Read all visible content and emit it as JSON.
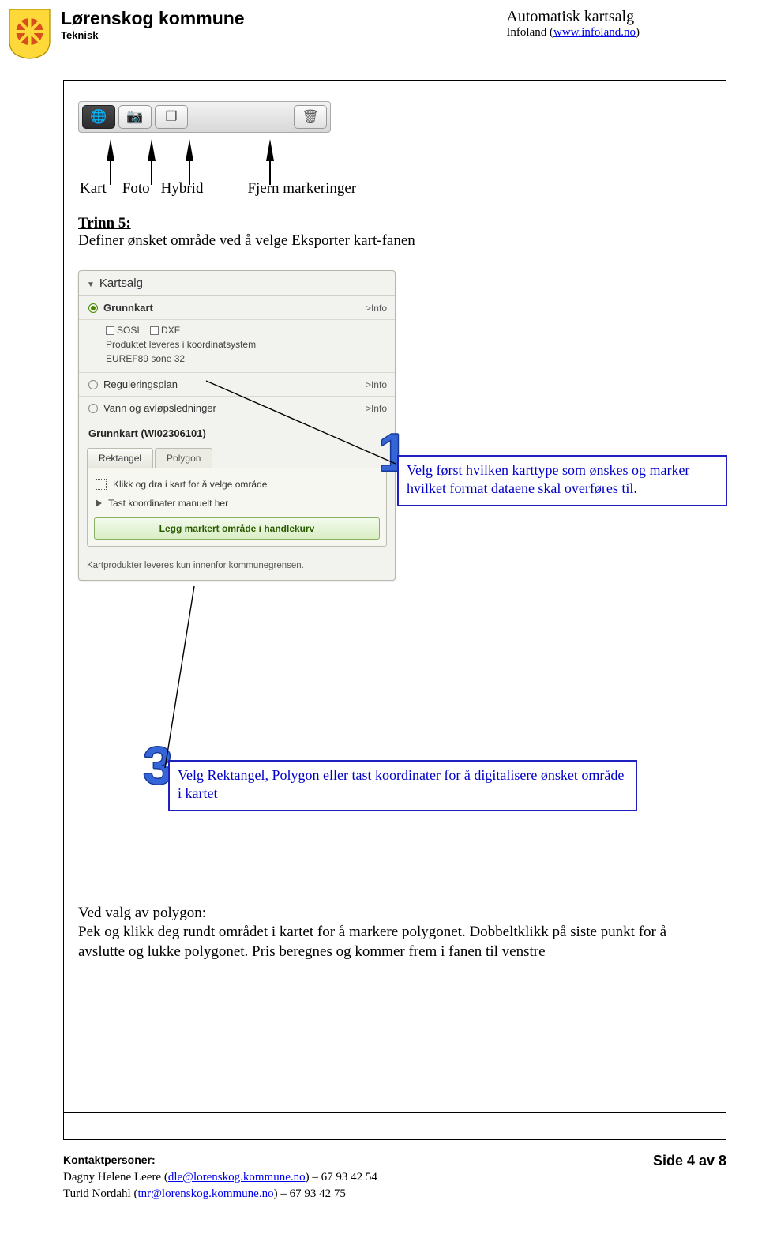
{
  "header": {
    "org_name": "Lørenskog kommune",
    "org_sub": "Teknisk",
    "title_main": "Automatisk kartsalg",
    "title_sub_prefix": "Infoland (",
    "title_sub_link": "www.infoland.no",
    "title_sub_suffix": ")"
  },
  "toolbar": {
    "labels": {
      "kart": "Kart",
      "foto": "Foto",
      "hybrid": "Hybrid",
      "fjern": "Fjern markeringer"
    }
  },
  "trinn": {
    "heading": "Trinn 5:",
    "text": "Definer ønsket område ved å velge Eksporter kart-fanen"
  },
  "panel": {
    "title": "Kartsalg",
    "items": {
      "grunnkart": "Grunnkart",
      "info": ">Info",
      "sosi": "SOSI",
      "dxf": "DXF",
      "prod_line1": "Produktet leveres i koordinatsystem",
      "prod_line2": "EUREF89 sone 32",
      "regplan": "Reguleringsplan",
      "vann": "Vann og avløpsledninger",
      "grunnkart_id": "Grunnkart (WI02306101)"
    },
    "tabs": {
      "rekt": "Rektangel",
      "poly": "Polygon"
    },
    "body": {
      "row1": "Klikk og dra i kart for å velge område",
      "row2": "Tast koordinater manuelt her",
      "btn": "Legg markert område i handlekurv"
    },
    "foot": "Kartprodukter leveres kun innenfor kommunegrensen."
  },
  "callouts": {
    "c1": "Velg først hvilken karttype som ønskes og marker hvilket format dataene skal overføres til.",
    "c3": "Velg Rektangel, Polygon eller tast koordinater for å digitalisere ønsket område i kartet",
    "n1": "1",
    "n3": "3"
  },
  "bottom": {
    "line1": "Ved valg av polygon:",
    "line2": "Pek og klikk deg rundt området i kartet for å markere polygonet. Dobbeltklikk på siste punkt for å avslutte og lukke polygonet. Pris beregnes og kommer frem i fanen til venstre"
  },
  "footer": {
    "heading": "Kontaktpersoner:",
    "l1_name": "Dagny Helene Leere (",
    "l1_mail": "dle@lorenskog.kommune.no",
    "l1_tail": ") – 67 93 42 54",
    "l2_name": "Turid Nordahl (",
    "l2_mail": "tnr@lorenskog.kommune.no",
    "l2_tail": ") – 67 93 42 75",
    "page": "Side 4 av 8"
  }
}
